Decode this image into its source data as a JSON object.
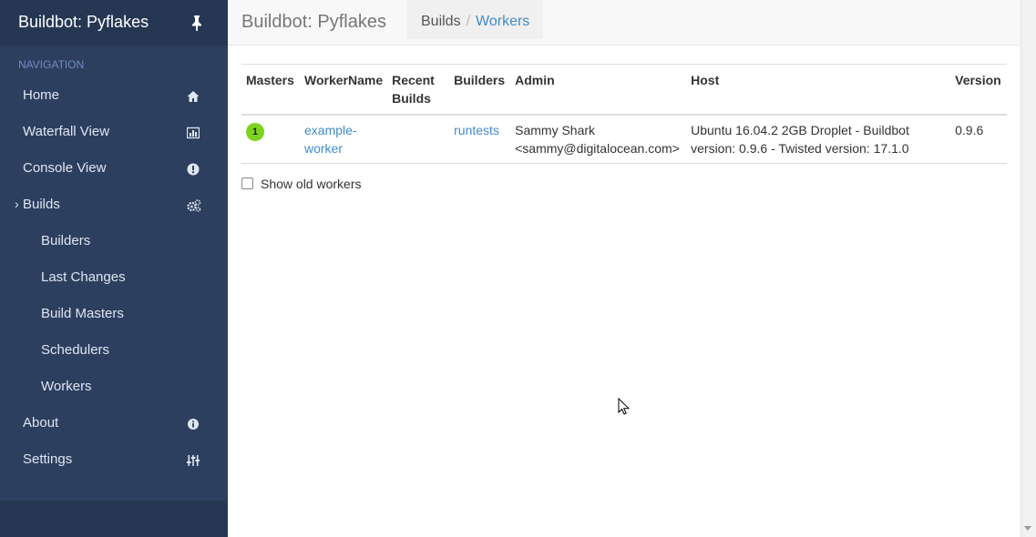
{
  "sidebar": {
    "brand": "Buildbot: Pyflakes",
    "pin_icon": "pin-icon",
    "nav_title": "NAVIGATION",
    "items": [
      {
        "label": "Home",
        "icon": "home-icon"
      },
      {
        "label": "Waterfall View",
        "icon": "bar-chart-icon"
      },
      {
        "label": "Console View",
        "icon": "exclamation-circle-icon"
      },
      {
        "label": "Builds",
        "icon": "gears-icon",
        "caret": "›"
      },
      {
        "label": "Builders"
      },
      {
        "label": "Last Changes"
      },
      {
        "label": "Build Masters"
      },
      {
        "label": "Schedulers"
      },
      {
        "label": "Workers"
      },
      {
        "label": "About",
        "icon": "info-circle-icon"
      },
      {
        "label": "Settings",
        "icon": "sliders-icon"
      }
    ]
  },
  "header": {
    "title": "Buildbot: Pyflakes",
    "breadcrumb": [
      "Builds",
      "Workers"
    ],
    "separator": "/"
  },
  "table": {
    "columns": [
      "Masters",
      "WorkerName",
      "Recent Builds",
      "Builders",
      "Admin",
      "Host",
      "Version"
    ],
    "rows": [
      {
        "masters": "1",
        "worker_name": "example-worker",
        "recent_builds": "",
        "builders": "runtests",
        "admin": "Sammy Shark <sammy@digitalocean.com>",
        "host": "Ubuntu 16.04.2 2GB Droplet - Buildbot version: 0.9.6 - Twisted version: 17.1.0",
        "version": "0.9.6"
      }
    ]
  },
  "show_old_workers": {
    "label": "Show old workers",
    "checked": false
  },
  "colors": {
    "sidebar_bg": "#2d3f5e",
    "link": "#428bca",
    "badge": "#7ed321"
  }
}
